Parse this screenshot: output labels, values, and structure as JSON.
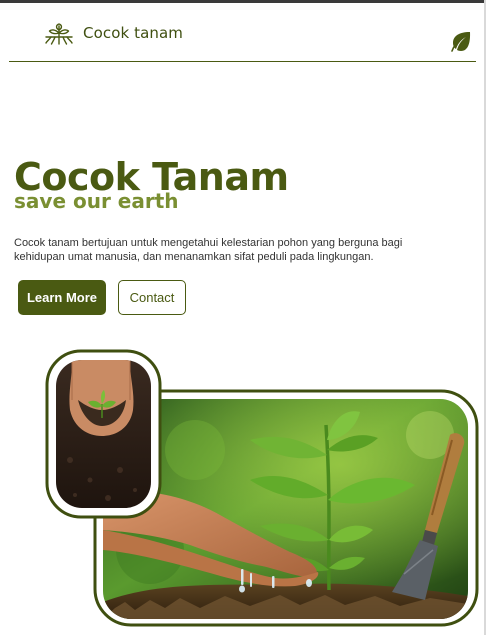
{
  "brand": {
    "name": "Cocok tanam",
    "logo_icon": "plant-sprout-icon"
  },
  "nav": {
    "menu_icon": "leaf-icon"
  },
  "hero": {
    "title": "Cocok Tanam",
    "subtitle": "save our earth",
    "description": "Cocok tanam bertujuan untuk mengetahui kelestarian pohon yang berguna bagi kehidupan umat manusia, dan menanamkan sifat peduli pada lingkungan."
  },
  "buttons": {
    "primary_label": "Learn More",
    "secondary_label": "Contact"
  },
  "colors": {
    "primary": "#4a5a12",
    "accent": "#7a8f32",
    "frame": "#3f4f10",
    "text": "#333333"
  }
}
